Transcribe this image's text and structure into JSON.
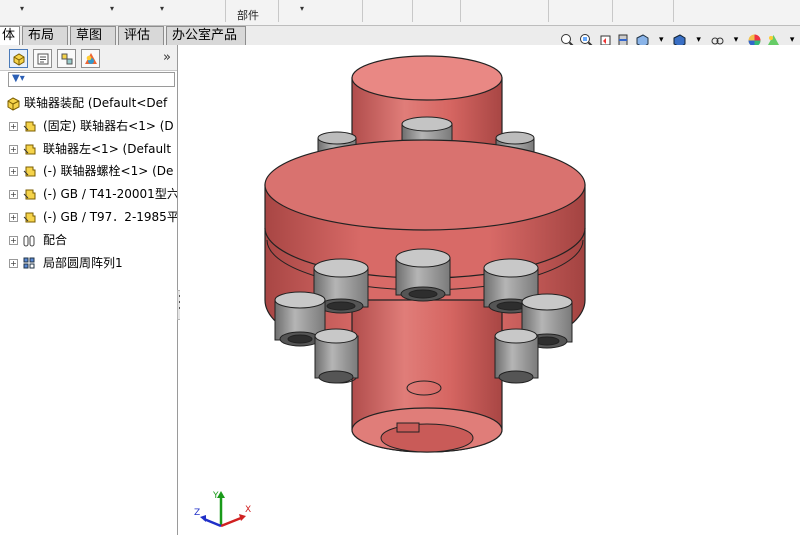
{
  "ribbon": {
    "partial_labels": [
      "部件"
    ]
  },
  "tabs": [
    {
      "label": "体",
      "active": true
    },
    {
      "label": "布局",
      "active": false
    },
    {
      "label": "草图",
      "active": false
    },
    {
      "label": "评估",
      "active": false
    },
    {
      "label": "办公室产品",
      "active": false
    }
  ],
  "panel": {
    "tab_icons": [
      "feature-manager-icon",
      "property-manager-icon",
      "configuration-manager-icon",
      "display-manager-icon"
    ],
    "more_label": "»",
    "filter_icon": "funnel-icon",
    "tree": [
      {
        "label": "联轴器装配  (Default<Def",
        "icon": "assembly-icon",
        "expandable": false
      },
      {
        "label": "(固定) 联轴器右<1> (D",
        "icon": "part-icon",
        "expandable": true
      },
      {
        "label": "联轴器左<1> (Default",
        "icon": "part-icon",
        "expandable": true
      },
      {
        "label": "(-) 联轴器螺栓<1> (De",
        "icon": "part-icon",
        "expandable": true
      },
      {
        "label": "(-) GB / T41-20001型六",
        "icon": "part-icon",
        "expandable": true
      },
      {
        "label": "(-) GB / T97．2-1985平",
        "icon": "part-icon",
        "expandable": true
      },
      {
        "label": "配合",
        "icon": "mates-icon",
        "expandable": true
      },
      {
        "label": "局部圆周阵列1",
        "icon": "pattern-icon",
        "expandable": true
      }
    ]
  },
  "viewport": {
    "model_color": "#d86a67",
    "bolt_color": "#8c8c8c"
  },
  "triad": {
    "x": "X",
    "y": "Y",
    "z": "Z"
  }
}
